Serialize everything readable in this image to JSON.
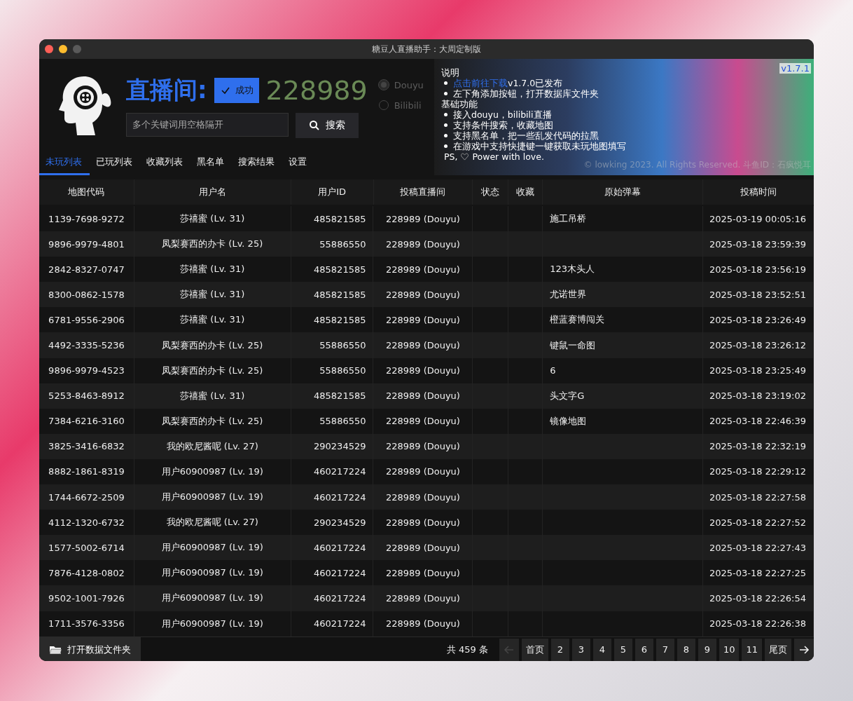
{
  "window": {
    "title": "糖豆人直播助手：大周定制版"
  },
  "header": {
    "room_label": "直播间:",
    "status": {
      "label": "成功",
      "ok": true
    },
    "room_id": "228989",
    "platforms": [
      {
        "label": "Douyu",
        "selected": true
      },
      {
        "label": "Bilibili",
        "selected": false
      }
    ],
    "search": {
      "placeholder": "多个关键词用空格隔开",
      "button": "搜索"
    }
  },
  "banner": {
    "version": "v1.7.1",
    "sections": [
      {
        "heading": "说明",
        "items": [
          {
            "link": "点击前往下载",
            "text": "v1.7.0已发布"
          },
          {
            "text": "左下角添加按钮，打开数据库文件夹"
          }
        ]
      },
      {
        "heading": "基础功能",
        "items": [
          {
            "text": "接入douyu，bilibili直播"
          },
          {
            "text": "支持条件搜索，收藏地图"
          },
          {
            "text": "支持黑名单，把一些乱发代码的拉黑"
          },
          {
            "text": "在游戏中支持快捷键一键获取未玩地图填写"
          }
        ]
      }
    ],
    "ps_prefix": "PS,",
    "ps_text": "Power with love.",
    "copyright": "© lowking 2023. All Rights Reserved.  斗鱼ID：石疯悦耳"
  },
  "tabs": [
    {
      "label": "未玩列表",
      "selected": true
    },
    {
      "label": "已玩列表",
      "selected": false
    },
    {
      "label": "收藏列表",
      "selected": false
    },
    {
      "label": "黑名单",
      "selected": false
    },
    {
      "label": "搜索结果",
      "selected": false
    },
    {
      "label": "设置",
      "selected": false
    }
  ],
  "table": {
    "columns": [
      "地图代码",
      "用户名",
      "用户ID",
      "投稿直播间",
      "状态",
      "收藏",
      "原始弹幕",
      "投稿时间"
    ],
    "rows": [
      [
        "1139-7698-9272",
        "莎禧蜜 (Lv. 31)",
        "485821585",
        "228989 (Douyu)",
        "",
        "",
        "施工吊桥",
        "2025-03-19 00:05:16"
      ],
      [
        "9896-9979-4801",
        "凤梨赛西的办卡 (Lv. 25)",
        "55886550",
        "228989 (Douyu)",
        "",
        "",
        "",
        "2025-03-18 23:59:39"
      ],
      [
        "2842-8327-0747",
        "莎禧蜜 (Lv. 31)",
        "485821585",
        "228989 (Douyu)",
        "",
        "",
        "123木头人",
        "2025-03-18 23:56:19"
      ],
      [
        "8300-0862-1578",
        "莎禧蜜 (Lv. 31)",
        "485821585",
        "228989 (Douyu)",
        "",
        "",
        "尤诺世界",
        "2025-03-18 23:52:51"
      ],
      [
        "6781-9556-2906",
        "莎禧蜜 (Lv. 31)",
        "485821585",
        "228989 (Douyu)",
        "",
        "",
        "橙蓝赛博闯关",
        "2025-03-18 23:26:49"
      ],
      [
        "4492-3335-5236",
        "凤梨赛西的办卡 (Lv. 25)",
        "55886550",
        "228989 (Douyu)",
        "",
        "",
        "键鼠一命图",
        "2025-03-18 23:26:12"
      ],
      [
        "9896-9979-4523",
        "凤梨赛西的办卡 (Lv. 25)",
        "55886550",
        "228989 (Douyu)",
        "",
        "",
        "6",
        "2025-03-18 23:25:49"
      ],
      [
        "5253-8463-8912",
        "莎禧蜜 (Lv. 31)",
        "485821585",
        "228989 (Douyu)",
        "",
        "",
        "头文字G",
        "2025-03-18 23:19:02"
      ],
      [
        "7384-6216-3160",
        "凤梨赛西的办卡 (Lv. 25)",
        "55886550",
        "228989 (Douyu)",
        "",
        "",
        "镜像地图",
        "2025-03-18 22:46:39"
      ],
      [
        "3825-3416-6832",
        "我的欧尼酱呢 (Lv. 27)",
        "290234529",
        "228989 (Douyu)",
        "",
        "",
        "",
        "2025-03-18 22:32:19"
      ],
      [
        "8882-1861-8319",
        "用户60900987 (Lv. 19)",
        "460217224",
        "228989 (Douyu)",
        "",
        "",
        "",
        "2025-03-18 22:29:12"
      ],
      [
        "1744-6672-2509",
        "用户60900987 (Lv. 19)",
        "460217224",
        "228989 (Douyu)",
        "",
        "",
        "",
        "2025-03-18 22:27:58"
      ],
      [
        "4112-1320-6732",
        "我的欧尼酱呢 (Lv. 27)",
        "290234529",
        "228989 (Douyu)",
        "",
        "",
        "",
        "2025-03-18 22:27:52"
      ],
      [
        "1577-5002-6714",
        "用户60900987 (Lv. 19)",
        "460217224",
        "228989 (Douyu)",
        "",
        "",
        "",
        "2025-03-18 22:27:43"
      ],
      [
        "7876-4128-0802",
        "用户60900987 (Lv. 19)",
        "460217224",
        "228989 (Douyu)",
        "",
        "",
        "",
        "2025-03-18 22:27:25"
      ],
      [
        "9502-1001-7926",
        "用户60900987 (Lv. 19)",
        "460217224",
        "228989 (Douyu)",
        "",
        "",
        "",
        "2025-03-18 22:26:54"
      ],
      [
        "1711-3576-3356",
        "用户60900987 (Lv. 19)",
        "460217224",
        "228989 (Douyu)",
        "",
        "",
        "",
        "2025-03-18 22:26:38"
      ]
    ]
  },
  "footer": {
    "open_folder": "打开数据文件夹",
    "total": "共 459 条",
    "prev_disabled": true,
    "next_disabled": false,
    "pages": [
      "首页",
      "2",
      "3",
      "4",
      "5",
      "6",
      "7",
      "8",
      "9",
      "10",
      "11",
      "尾页"
    ]
  }
}
